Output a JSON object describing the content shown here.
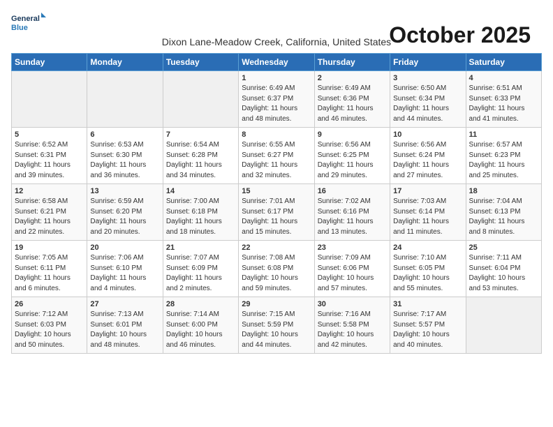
{
  "logo": {
    "line1": "General",
    "line2": "Blue"
  },
  "title": "October 2025",
  "subtitle": "Dixon Lane-Meadow Creek, California, United States",
  "headers": [
    "Sunday",
    "Monday",
    "Tuesday",
    "Wednesday",
    "Thursday",
    "Friday",
    "Saturday"
  ],
  "weeks": [
    [
      {
        "day": "",
        "info": ""
      },
      {
        "day": "",
        "info": ""
      },
      {
        "day": "",
        "info": ""
      },
      {
        "day": "1",
        "info": "Sunrise: 6:49 AM\nSunset: 6:37 PM\nDaylight: 11 hours\nand 48 minutes."
      },
      {
        "day": "2",
        "info": "Sunrise: 6:49 AM\nSunset: 6:36 PM\nDaylight: 11 hours\nand 46 minutes."
      },
      {
        "day": "3",
        "info": "Sunrise: 6:50 AM\nSunset: 6:34 PM\nDaylight: 11 hours\nand 44 minutes."
      },
      {
        "day": "4",
        "info": "Sunrise: 6:51 AM\nSunset: 6:33 PM\nDaylight: 11 hours\nand 41 minutes."
      }
    ],
    [
      {
        "day": "5",
        "info": "Sunrise: 6:52 AM\nSunset: 6:31 PM\nDaylight: 11 hours\nand 39 minutes."
      },
      {
        "day": "6",
        "info": "Sunrise: 6:53 AM\nSunset: 6:30 PM\nDaylight: 11 hours\nand 36 minutes."
      },
      {
        "day": "7",
        "info": "Sunrise: 6:54 AM\nSunset: 6:28 PM\nDaylight: 11 hours\nand 34 minutes."
      },
      {
        "day": "8",
        "info": "Sunrise: 6:55 AM\nSunset: 6:27 PM\nDaylight: 11 hours\nand 32 minutes."
      },
      {
        "day": "9",
        "info": "Sunrise: 6:56 AM\nSunset: 6:25 PM\nDaylight: 11 hours\nand 29 minutes."
      },
      {
        "day": "10",
        "info": "Sunrise: 6:56 AM\nSunset: 6:24 PM\nDaylight: 11 hours\nand 27 minutes."
      },
      {
        "day": "11",
        "info": "Sunrise: 6:57 AM\nSunset: 6:23 PM\nDaylight: 11 hours\nand 25 minutes."
      }
    ],
    [
      {
        "day": "12",
        "info": "Sunrise: 6:58 AM\nSunset: 6:21 PM\nDaylight: 11 hours\nand 22 minutes."
      },
      {
        "day": "13",
        "info": "Sunrise: 6:59 AM\nSunset: 6:20 PM\nDaylight: 11 hours\nand 20 minutes."
      },
      {
        "day": "14",
        "info": "Sunrise: 7:00 AM\nSunset: 6:18 PM\nDaylight: 11 hours\nand 18 minutes."
      },
      {
        "day": "15",
        "info": "Sunrise: 7:01 AM\nSunset: 6:17 PM\nDaylight: 11 hours\nand 15 minutes."
      },
      {
        "day": "16",
        "info": "Sunrise: 7:02 AM\nSunset: 6:16 PM\nDaylight: 11 hours\nand 13 minutes."
      },
      {
        "day": "17",
        "info": "Sunrise: 7:03 AM\nSunset: 6:14 PM\nDaylight: 11 hours\nand 11 minutes."
      },
      {
        "day": "18",
        "info": "Sunrise: 7:04 AM\nSunset: 6:13 PM\nDaylight: 11 hours\nand 8 minutes."
      }
    ],
    [
      {
        "day": "19",
        "info": "Sunrise: 7:05 AM\nSunset: 6:11 PM\nDaylight: 11 hours\nand 6 minutes."
      },
      {
        "day": "20",
        "info": "Sunrise: 7:06 AM\nSunset: 6:10 PM\nDaylight: 11 hours\nand 4 minutes."
      },
      {
        "day": "21",
        "info": "Sunrise: 7:07 AM\nSunset: 6:09 PM\nDaylight: 11 hours\nand 2 minutes."
      },
      {
        "day": "22",
        "info": "Sunrise: 7:08 AM\nSunset: 6:08 PM\nDaylight: 10 hours\nand 59 minutes."
      },
      {
        "day": "23",
        "info": "Sunrise: 7:09 AM\nSunset: 6:06 PM\nDaylight: 10 hours\nand 57 minutes."
      },
      {
        "day": "24",
        "info": "Sunrise: 7:10 AM\nSunset: 6:05 PM\nDaylight: 10 hours\nand 55 minutes."
      },
      {
        "day": "25",
        "info": "Sunrise: 7:11 AM\nSunset: 6:04 PM\nDaylight: 10 hours\nand 53 minutes."
      }
    ],
    [
      {
        "day": "26",
        "info": "Sunrise: 7:12 AM\nSunset: 6:03 PM\nDaylight: 10 hours\nand 50 minutes."
      },
      {
        "day": "27",
        "info": "Sunrise: 7:13 AM\nSunset: 6:01 PM\nDaylight: 10 hours\nand 48 minutes."
      },
      {
        "day": "28",
        "info": "Sunrise: 7:14 AM\nSunset: 6:00 PM\nDaylight: 10 hours\nand 46 minutes."
      },
      {
        "day": "29",
        "info": "Sunrise: 7:15 AM\nSunset: 5:59 PM\nDaylight: 10 hours\nand 44 minutes."
      },
      {
        "day": "30",
        "info": "Sunrise: 7:16 AM\nSunset: 5:58 PM\nDaylight: 10 hours\nand 42 minutes."
      },
      {
        "day": "31",
        "info": "Sunrise: 7:17 AM\nSunset: 5:57 PM\nDaylight: 10 hours\nand 40 minutes."
      },
      {
        "day": "",
        "info": ""
      }
    ]
  ]
}
